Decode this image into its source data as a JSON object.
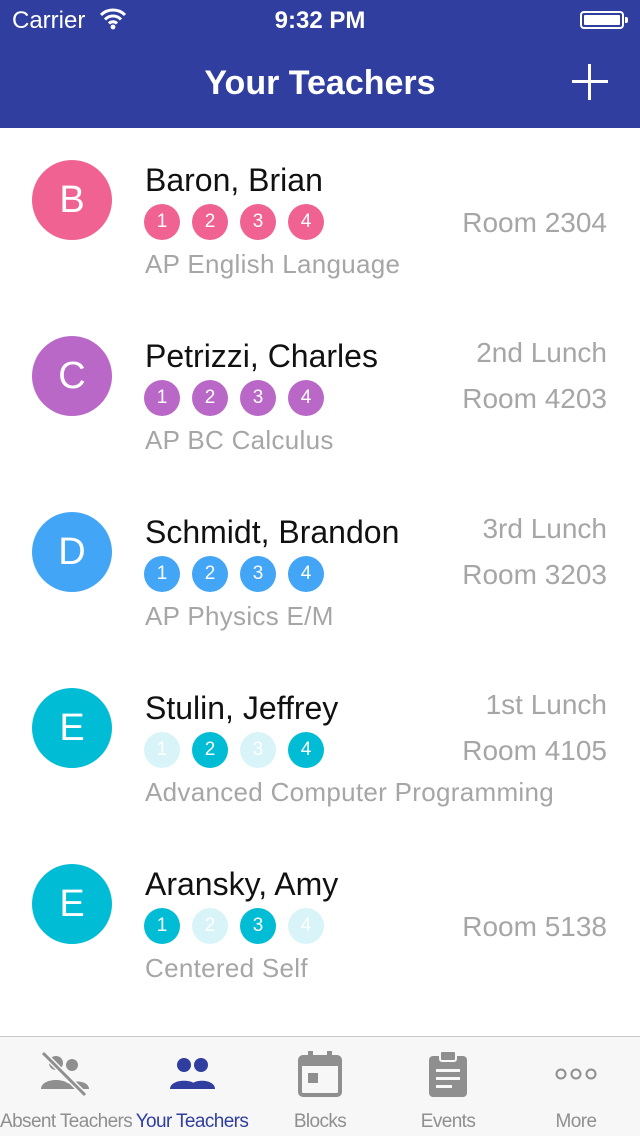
{
  "status_bar": {
    "carrier": "Carrier",
    "time": "9:32 PM"
  },
  "nav": {
    "title": "Your Teachers",
    "add_icon": "plus-icon"
  },
  "colors": {
    "header": "#303f9f",
    "pink": "#f06292",
    "purple": "#ba68c8",
    "blue": "#42a5f5",
    "cyan": "#00bcd4"
  },
  "teachers": [
    {
      "initial": "B",
      "name": "Baron, Brian",
      "color": "#f06292",
      "blocks": [
        {
          "label": "1",
          "active": true
        },
        {
          "label": "2",
          "active": true
        },
        {
          "label": "3",
          "active": true
        },
        {
          "label": "4",
          "active": true
        }
      ],
      "course": "AP English Language",
      "lunch": "",
      "room": "Room 2304"
    },
    {
      "initial": "C",
      "name": "Petrizzi, Charles",
      "color": "#ba68c8",
      "blocks": [
        {
          "label": "1",
          "active": true
        },
        {
          "label": "2",
          "active": true
        },
        {
          "label": "3",
          "active": true
        },
        {
          "label": "4",
          "active": true
        }
      ],
      "course": "AP BC Calculus",
      "lunch": "2nd Lunch",
      "room": "Room 4203"
    },
    {
      "initial": "D",
      "name": "Schmidt, Brandon",
      "color": "#42a5f5",
      "blocks": [
        {
          "label": "1",
          "active": true
        },
        {
          "label": "2",
          "active": true
        },
        {
          "label": "3",
          "active": true
        },
        {
          "label": "4",
          "active": true
        }
      ],
      "course": "AP Physics E/M",
      "lunch": "3rd Lunch",
      "room": "Room 3203"
    },
    {
      "initial": "E",
      "name": "Stulin, Jeffrey",
      "color": "#00bcd4",
      "blocks": [
        {
          "label": "1",
          "active": false
        },
        {
          "label": "2",
          "active": true
        },
        {
          "label": "3",
          "active": false
        },
        {
          "label": "4",
          "active": true
        }
      ],
      "course": "Advanced Computer Programming",
      "lunch": "1st Lunch",
      "room": "Room 4105"
    },
    {
      "initial": "E",
      "name": "Aransky, Amy",
      "color": "#00bcd4",
      "blocks": [
        {
          "label": "1",
          "active": true
        },
        {
          "label": "2",
          "active": false
        },
        {
          "label": "3",
          "active": true
        },
        {
          "label": "4",
          "active": false
        }
      ],
      "course": "Centered Self",
      "lunch": "",
      "room": "Room 5138"
    }
  ],
  "tabs": [
    {
      "label": "Absent Teachers",
      "icon": "absent-teachers-icon",
      "active": false
    },
    {
      "label": "Your Teachers",
      "icon": "your-teachers-icon",
      "active": true
    },
    {
      "label": "Blocks",
      "icon": "calendar-icon",
      "active": false
    },
    {
      "label": "Events",
      "icon": "clipboard-icon",
      "active": false
    },
    {
      "label": "More",
      "icon": "more-icon",
      "active": false
    }
  ]
}
